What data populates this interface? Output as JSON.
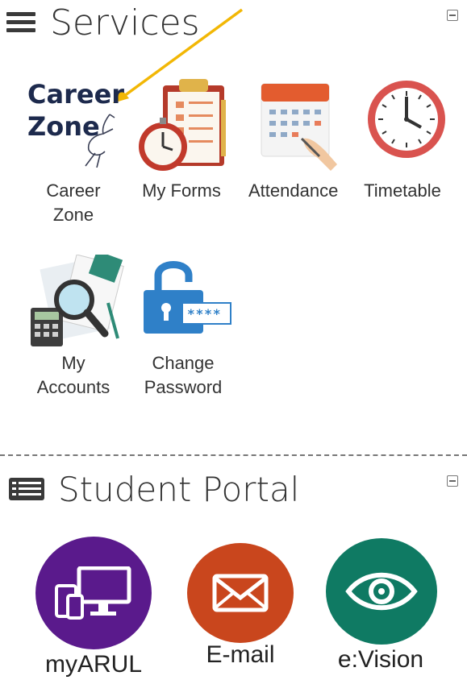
{
  "services": {
    "title": "Services",
    "items": [
      {
        "label_line1": "Career",
        "label_line2": "Zone",
        "icon": "career-zone-logo",
        "logo_line1": "Career",
        "logo_line2": "Zone"
      },
      {
        "label_line1": "My Forms",
        "label_line2": "",
        "icon": "clipboard-stopwatch-icon"
      },
      {
        "label_line1": "Attendance",
        "label_line2": "",
        "icon": "calendar-icon"
      },
      {
        "label_line1": "Timetable",
        "label_line2": "",
        "icon": "clock-icon"
      },
      {
        "label_line1": "My",
        "label_line2": "Accounts",
        "icon": "accounts-magnifier-icon"
      },
      {
        "label_line1": "Change",
        "label_line2": "Password",
        "icon": "padlock-icon",
        "password_mask": "****"
      }
    ]
  },
  "student_portal": {
    "title": "Student Portal",
    "items": [
      {
        "label": "myARUL",
        "icon": "devices-icon",
        "color": "#5a1a8c"
      },
      {
        "label": "E-mail",
        "icon": "envelope-icon",
        "color": "#c9461d"
      },
      {
        "label": "e:Vision",
        "icon": "eye-icon",
        "color": "#0f7a63"
      }
    ]
  },
  "colors": {
    "annotation_arrow": "#f2b705",
    "career_zone_text": "#1d2a4d"
  }
}
